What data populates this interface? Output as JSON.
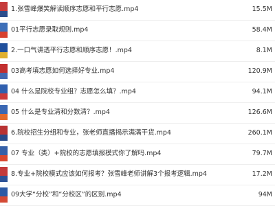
{
  "files": [
    {
      "name": "1.张雪峰爆笑解读顺序志愿和平行志愿.mp4",
      "size": "15.5M",
      "colors": [
        "#c63b3b",
        "#2b4e8c"
      ]
    },
    {
      "name": "01平行志愿录取规则.mp4",
      "size": "58.4M",
      "colors": [
        "#3d6fb8",
        "#d8412f"
      ]
    },
    {
      "name": "2.一口气讲透平行志愿和顺序志愿！.mp4",
      "size": "8.1M",
      "colors": [
        "#1f4f9c",
        "#e0b02f"
      ]
    },
    {
      "name": "03高考填志愿如何选择好专业.mp4",
      "size": "120.9M",
      "colors": [
        "#c22f2f",
        "#4468b0"
      ]
    },
    {
      "name": "04 什么是院校专业组？志愿怎么填？.mp4",
      "size": "94.1M",
      "colors": [
        "#2f5fae",
        "#cc3a3a"
      ]
    },
    {
      "name": "05 什么是专业清和分数清？.mp4",
      "size": "126.6M",
      "colors": [
        "#3a67b3",
        "#e36b2c"
      ]
    },
    {
      "name": "6.院校招生分组和专业，张老师直播揭示满满干货.mp4",
      "size": "260.1M",
      "colors": [
        "#b83232",
        "#274a8a"
      ]
    },
    {
      "name": "07 专业（类）+院校的志愿填报模式你了解吗.mp4",
      "size": "79.7M",
      "colors": [
        "#3560a8",
        "#d9482f"
      ]
    },
    {
      "name": "8.专业+院校模式应该如何报考？张雪峰老师讲解3个报考逻辑.mp4",
      "size": "17.2M",
      "colors": [
        "#c43a3a",
        "#2d5296"
      ]
    },
    {
      "name": "09大学“分校”和“分校区”的区别.mp4",
      "size": "94M",
      "colors": [
        "#2c5aa5",
        "#d44a35"
      ]
    }
  ]
}
